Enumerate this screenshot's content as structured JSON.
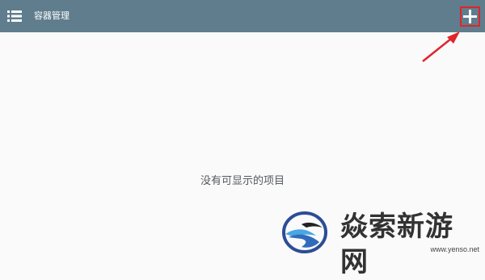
{
  "appbar": {
    "title": "容器管理",
    "menu_icon": "list-menu-icon",
    "add_icon": "plus-icon",
    "background": "#5f7d8c"
  },
  "main": {
    "empty_message": "没有可显示的项目"
  },
  "annotation": {
    "color": "#e0252b",
    "highlight_target": "add-button"
  },
  "watermark": {
    "name": "焱索新游网",
    "url": "www.yenso.net"
  }
}
